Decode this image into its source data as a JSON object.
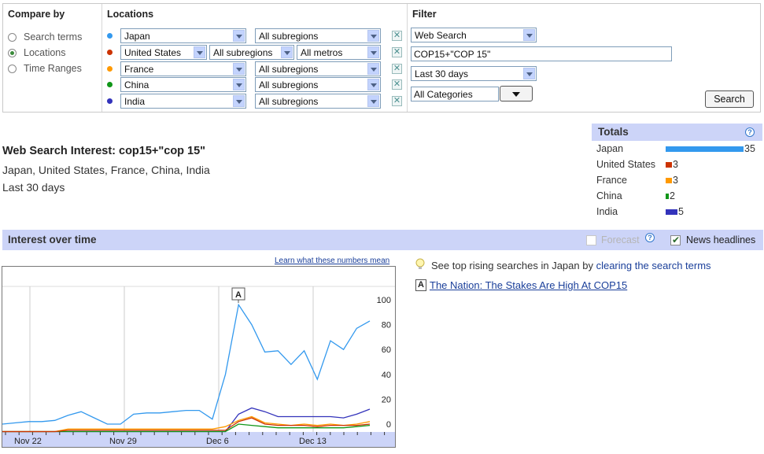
{
  "compare": {
    "header": "Compare by",
    "options": [
      {
        "label": "Search terms",
        "selected": false
      },
      {
        "label": "Locations",
        "selected": true
      },
      {
        "label": "Time Ranges",
        "selected": false
      }
    ]
  },
  "locations": {
    "header": "Locations",
    "rows": [
      {
        "country": "Japan",
        "color": "#3399ee",
        "sub": "All subregions",
        "metro": null
      },
      {
        "country": "United States",
        "color": "#cc3300",
        "sub": "All subregions",
        "metro": "All metros"
      },
      {
        "country": "France",
        "color": "#ff9900",
        "sub": "All subregions",
        "metro": null
      },
      {
        "country": "China",
        "color": "#109618",
        "sub": "All subregions",
        "metro": null
      },
      {
        "country": "India",
        "color": "#3333bb",
        "sub": "All subregions",
        "metro": null
      }
    ],
    "remove_glyph": "✕"
  },
  "filter": {
    "header": "Filter",
    "property": "Web Search",
    "query": "COP15+\"COP 15\"",
    "range": "Last 30 days",
    "category": "All Categories",
    "search_label": "Search"
  },
  "summary": {
    "title": "Web Search Interest: cop15+\"cop 15\"",
    "locations": "Japan, United States, France, China, India",
    "period": "Last 30 days"
  },
  "totals": {
    "header": "Totals",
    "help": "?",
    "rows": [
      {
        "name": "Japan",
        "value": "35",
        "color": "#3399ee"
      },
      {
        "name": "United States",
        "value": "3",
        "color": "#cc3300"
      },
      {
        "name": "France",
        "value": "3",
        "color": "#ff9900"
      },
      {
        "name": "China",
        "value": "2",
        "color": "#109618"
      },
      {
        "name": "India",
        "value": "5",
        "color": "#3333bb"
      }
    ]
  },
  "interest": {
    "header": "Interest over time",
    "forecast_label": "Forecast",
    "forecast_help": "?",
    "news_label": "News headlines",
    "news_checked": true,
    "learn_link": "Learn what these numbers mean"
  },
  "rising": {
    "prefix": "See top rising searches in Japan by ",
    "link": "clearing the search terms"
  },
  "news": {
    "marker": "A",
    "headline": "The Nation: The Stakes Are High At COP15"
  },
  "chart_data": {
    "type": "line",
    "x_ticks": [
      "Nov 22",
      "Nov 29",
      "Dec 6",
      "Dec 13"
    ],
    "y_ticks": [
      "100",
      "80",
      "60",
      "40",
      "20",
      "0"
    ],
    "ylim": [
      0,
      100
    ],
    "grid": true,
    "annotation": {
      "label": "A",
      "index": 24
    },
    "series": [
      {
        "name": "Japan",
        "color": "#3399ee",
        "values": [
          0,
          1,
          2,
          2,
          3,
          7,
          10,
          5,
          0,
          0,
          8,
          9,
          9,
          10,
          11,
          11,
          4,
          40,
          96,
          80,
          58,
          59,
          48,
          59,
          36,
          67,
          60,
          77,
          83
        ]
      },
      {
        "name": "United States",
        "color": "#cc3300",
        "values": [
          -6,
          -6,
          -6,
          -6,
          -6,
          -5,
          -5,
          -5,
          -5,
          -5,
          -5,
          -5,
          -5,
          -5,
          -5,
          -5,
          -5,
          -5,
          2,
          5,
          0,
          -1,
          -1,
          -1,
          -2,
          -1,
          -1,
          -1,
          0
        ]
      },
      {
        "name": "France",
        "color": "#ff9900",
        "values": [
          -6,
          -6,
          -6,
          -6,
          -6,
          -4,
          -4,
          -4,
          -4,
          -4,
          -4,
          -4,
          -4,
          -4,
          -4,
          -4,
          -4,
          -2,
          3,
          6,
          1,
          0,
          -1,
          0,
          -1,
          0,
          -1,
          0,
          2
        ]
      },
      {
        "name": "China",
        "color": "#109618",
        "values": [
          -6,
          -6,
          -6,
          -6,
          -6,
          -6,
          -6,
          -6,
          -6,
          -6,
          -6,
          -6,
          -6,
          -6,
          -6,
          -6,
          -6,
          -6,
          0,
          -1,
          -2,
          -3,
          -3,
          -3,
          -3,
          -3,
          -3,
          -2,
          -1
        ]
      },
      {
        "name": "India",
        "color": "#3333bb",
        "values": [
          -6,
          -6,
          -6,
          -6,
          -6,
          -6,
          -6,
          -6,
          -6,
          -6,
          -6,
          -6,
          -6,
          -6,
          -6,
          -6,
          -6,
          -6,
          8,
          13,
          10,
          6,
          6,
          6,
          6,
          6,
          5,
          8,
          12
        ]
      }
    ]
  }
}
